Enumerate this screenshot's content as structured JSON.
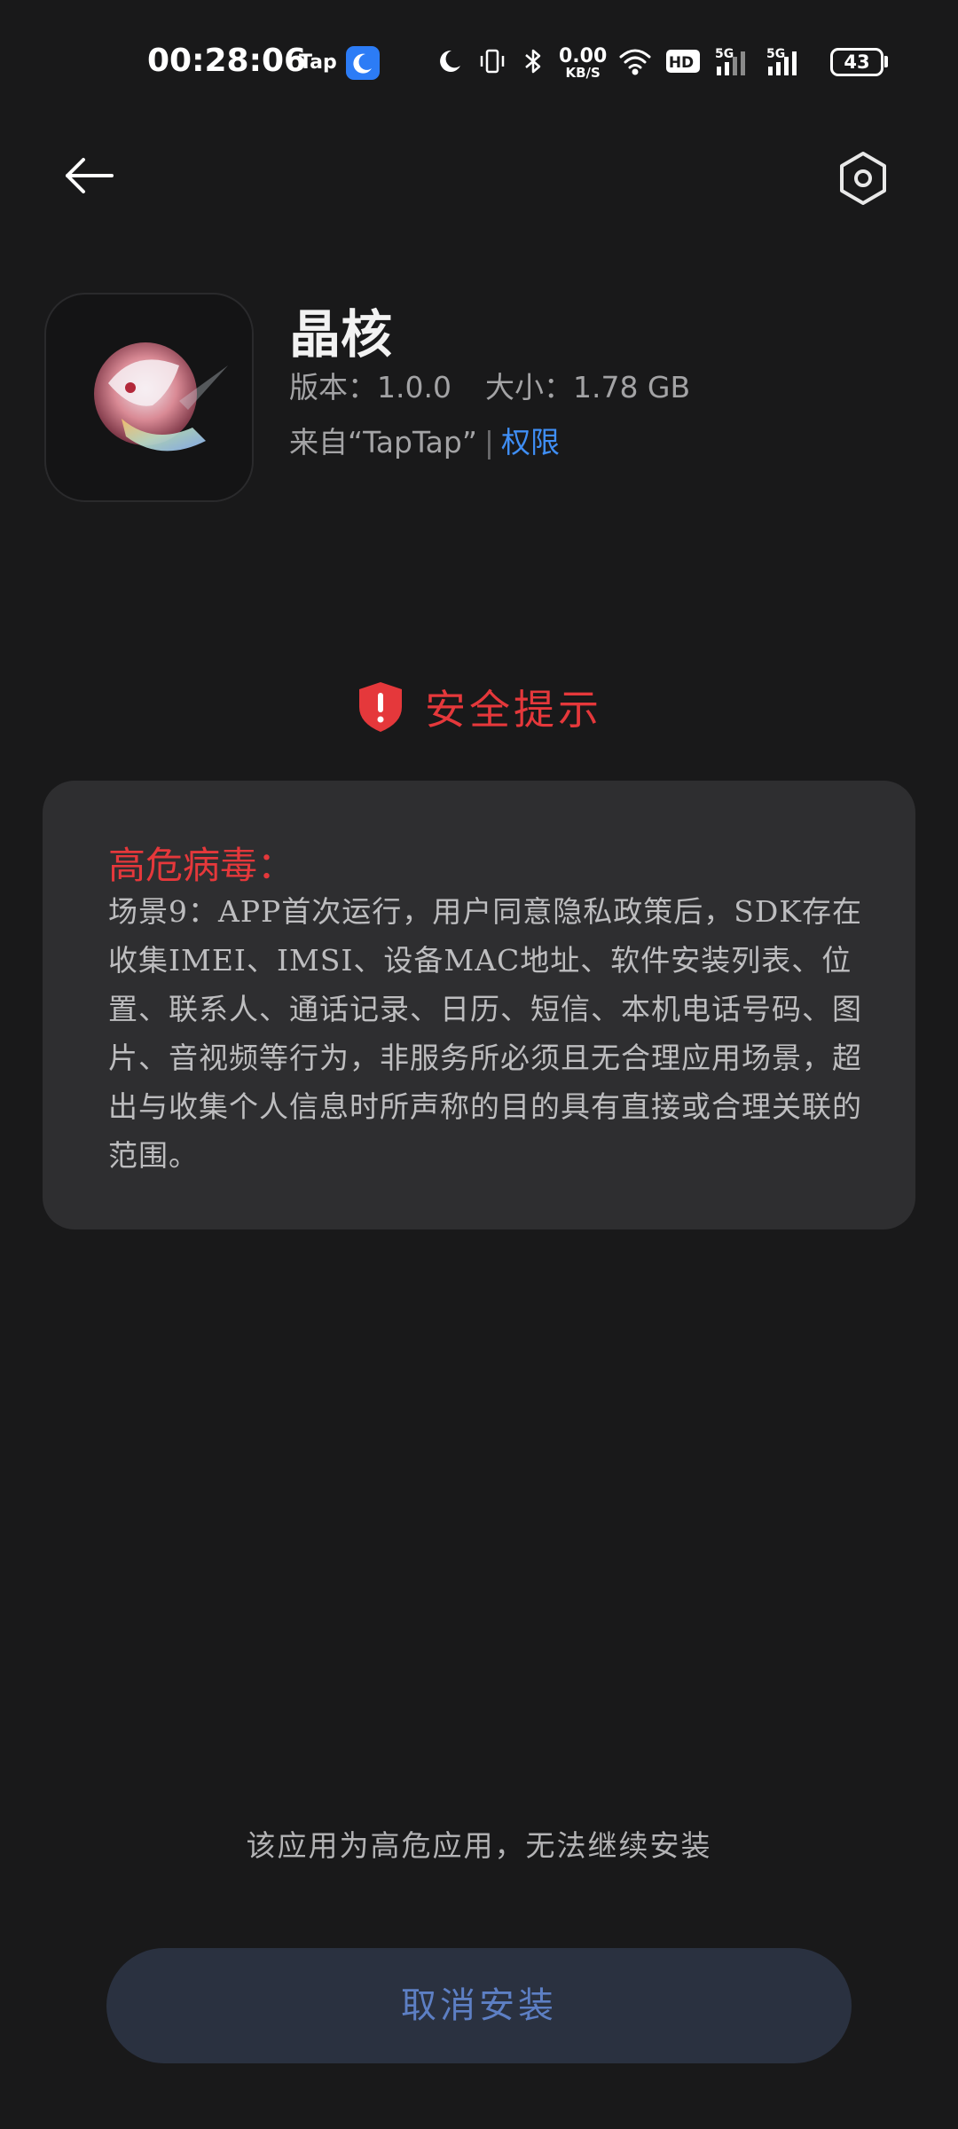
{
  "status_bar": {
    "time": "00:28:06",
    "tap_label": "Tap",
    "net_speed_value": "0.00",
    "net_speed_unit": "KB/S",
    "hd_label": "HD",
    "signal1_label": "5G",
    "signal2_label": "5G",
    "battery": "43",
    "icons": [
      "moon-badge-icon",
      "moon-icon",
      "vibrate-icon",
      "bluetooth-icon",
      "wifi-icon",
      "hd-icon",
      "signal-icon",
      "signal-icon",
      "battery-icon"
    ]
  },
  "header": {
    "back_icon": "arrow-left-icon",
    "settings_icon": "hexagon-settings-icon"
  },
  "app": {
    "name": "晶核",
    "version_label": "版本：1.0.0",
    "size_label": "大小：1.78 GB",
    "source_label": "来自“TapTap”",
    "separator": "|",
    "permissions_link": "权限"
  },
  "security": {
    "title": "安全提示",
    "warning_heading": "高危病毒：",
    "warning_body": "场景9：APP首次运行，用户同意隐私政策后，SDK存在收集IMEI、IMSI、设备MAC地址、软件安装列表、位置、联系人、通话记录、日历、短信、本机电话号码、图片、音视频等行为，非服务所必须且无合理应用场景，超出与收集个人信息时所声称的目的具有直接或合理关联的范围。"
  },
  "footer": {
    "notice": "该应用为高危应用，无法继续安装",
    "cancel_button": "取消安装"
  },
  "colors": {
    "background": "#19191a",
    "danger": "#e5383b",
    "link": "#3f8ef5",
    "card": "#2e2e30",
    "button_bg": "#2a3140",
    "button_text": "#5d7fc4"
  }
}
